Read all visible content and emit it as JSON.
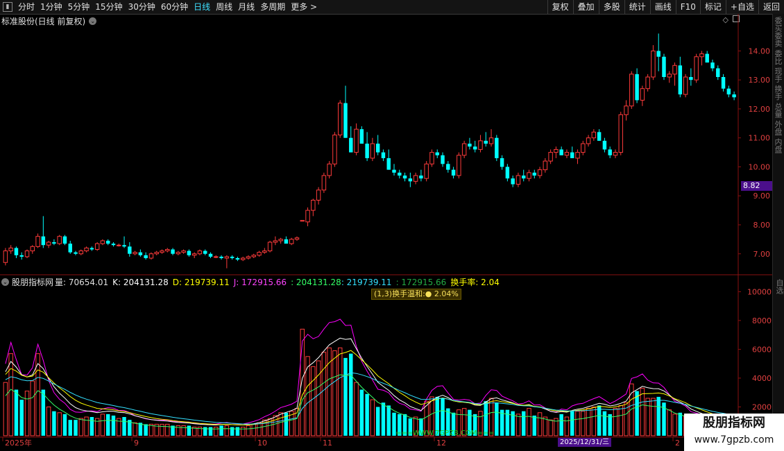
{
  "toolbar": {
    "periods": [
      "分时",
      "1分钟",
      "5分钟",
      "15分钟",
      "30分钟",
      "60分钟",
      "日线",
      "周线",
      "月线",
      "多周期",
      "更多 >"
    ],
    "active_period": "日线",
    "actions": [
      "复权",
      "叠加",
      "多股",
      "统计",
      "画线",
      "F10",
      "标记",
      "+自选",
      "返回"
    ]
  },
  "chart_title": "标准股份(日线 前复权)",
  "price_axis_labels": [
    "14.00",
    "13.00",
    "12.00",
    "11.00",
    "10.00",
    "9.00",
    "8.00",
    "7.00"
  ],
  "current_price_tag": "8.82",
  "indicator_header": {
    "name": "股朋指标网",
    "vol": "量: 70654.01",
    "k": "K: 204131.28",
    "d": "D: 219739.11",
    "j": "J: 172915.66",
    "v4": ": 204131.28",
    "v5": ": 219739.11",
    "v6": ": 172915.66",
    "turnover": "换手率: 2.04"
  },
  "badge": "(1,3)换手温和:● 2.04%",
  "volume_axis_labels": [
    "10000",
    "8000",
    "6000",
    "4000",
    "2000"
  ],
  "date_labels": [
    "2025年",
    "9",
    "10",
    "11",
    "12",
    "2"
  ],
  "date_tag": "2025/12/31/三",
  "watermark_line": "===WWW.7GPZB.COM===",
  "right_strip_text": "委买委卖 委比 现手 换手 总量 外盘 内盘",
  "right_strip_text2": "自选",
  "watermark": {
    "line1": "股朋指标网",
    "line2": "www.7gpzb.com"
  },
  "colors": {
    "up": "#ff3b3b",
    "down": "#00ffff",
    "k": "#ffffff",
    "d": "#ffff00",
    "j": "#ff00ff",
    "active": "#3fe0ff"
  },
  "chart_data": {
    "type": "candlestick",
    "title": "标准股份(日线 前复权)",
    "ylim": [
      6.3,
      14.8
    ],
    "ohlc": [
      [
        6.7,
        7.2,
        6.6,
        7.1
      ],
      [
        7.1,
        7.3,
        7.0,
        7.2
      ],
      [
        7.2,
        7.25,
        6.85,
        6.95
      ],
      [
        6.95,
        7.05,
        6.8,
        6.9
      ],
      [
        6.9,
        7.15,
        6.85,
        7.1
      ],
      [
        7.1,
        7.3,
        7.0,
        7.25
      ],
      [
        7.25,
        7.7,
        7.2,
        7.6
      ],
      [
        7.6,
        8.3,
        7.2,
        7.3
      ],
      [
        7.3,
        7.45,
        7.2,
        7.4
      ],
      [
        7.4,
        7.5,
        7.3,
        7.35
      ],
      [
        7.35,
        7.65,
        7.3,
        7.6
      ],
      [
        7.6,
        7.65,
        7.3,
        7.35
      ],
      [
        7.35,
        7.45,
        7.0,
        7.05
      ],
      [
        7.05,
        7.1,
        6.95,
        7.0
      ],
      [
        7.0,
        7.15,
        6.95,
        7.1
      ],
      [
        7.1,
        7.25,
        7.05,
        7.2
      ],
      [
        7.2,
        7.25,
        7.1,
        7.15
      ],
      [
        7.15,
        7.4,
        7.1,
        7.35
      ],
      [
        7.35,
        7.5,
        7.3,
        7.45
      ],
      [
        7.45,
        7.5,
        7.3,
        7.35
      ],
      [
        7.35,
        7.4,
        7.25,
        7.3
      ],
      [
        7.3,
        7.35,
        7.25,
        7.3
      ],
      [
        7.3,
        7.6,
        7.2,
        7.25
      ],
      [
        7.25,
        7.4,
        6.9,
        7.0
      ],
      [
        7.0,
        7.1,
        6.95,
        7.05
      ],
      [
        7.05,
        7.15,
        6.9,
        6.95
      ],
      [
        6.95,
        7.05,
        6.8,
        6.85
      ],
      [
        6.85,
        7.05,
        6.8,
        7.0
      ],
      [
        7.0,
        7.1,
        6.95,
        7.05
      ],
      [
        7.05,
        7.15,
        7.0,
        7.1
      ],
      [
        7.1,
        7.2,
        7.05,
        7.15
      ],
      [
        7.15,
        7.2,
        6.95,
        7.0
      ],
      [
        7.0,
        7.1,
        6.95,
        7.05
      ],
      [
        7.05,
        7.15,
        7.0,
        7.1
      ],
      [
        7.1,
        7.15,
        6.9,
        6.95
      ],
      [
        6.95,
        7.05,
        6.85,
        7.0
      ],
      [
        7.0,
        7.15,
        6.95,
        7.1
      ],
      [
        7.1,
        7.15,
        6.95,
        7.0
      ],
      [
        7.0,
        7.05,
        6.85,
        6.9
      ],
      [
        6.9,
        6.95,
        6.85,
        6.9
      ],
      [
        6.9,
        6.95,
        6.8,
        6.85
      ],
      [
        6.85,
        6.95,
        6.5,
        6.9
      ],
      [
        6.9,
        6.95,
        6.8,
        6.85
      ],
      [
        6.85,
        6.9,
        6.75,
        6.8
      ],
      [
        6.8,
        6.9,
        6.75,
        6.85
      ],
      [
        6.85,
        6.95,
        6.8,
        6.9
      ],
      [
        6.9,
        7.0,
        6.85,
        6.95
      ],
      [
        6.95,
        7.1,
        6.9,
        7.05
      ],
      [
        7.05,
        7.2,
        7.0,
        7.1
      ],
      [
        7.1,
        7.45,
        7.05,
        7.4
      ],
      [
        7.4,
        7.6,
        7.3,
        7.45
      ],
      [
        7.45,
        7.55,
        7.35,
        7.5
      ],
      [
        7.5,
        7.6,
        7.4,
        7.35
      ],
      [
        7.35,
        7.55,
        7.3,
        7.5
      ],
      [
        7.5,
        7.6,
        7.45,
        7.55
      ],
      [
        8.15,
        8.15,
        8.15,
        8.15
      ],
      [
        8.1,
        8.6,
        7.95,
        8.5
      ],
      [
        8.5,
        8.9,
        8.3,
        8.85
      ],
      [
        8.85,
        9.3,
        8.7,
        9.2
      ],
      [
        9.2,
        9.8,
        9.1,
        9.7
      ],
      [
        9.7,
        10.2,
        9.6,
        10.1
      ],
      [
        10.1,
        11.2,
        10.0,
        11.1
      ],
      [
        11.1,
        12.3,
        11.0,
        12.2
      ],
      [
        12.2,
        12.8,
        11.0,
        11.0
      ],
      [
        11.0,
        11.4,
        10.5,
        10.5
      ],
      [
        10.5,
        11.5,
        10.4,
        11.3
      ],
      [
        11.3,
        11.4,
        10.8,
        10.8
      ],
      [
        10.8,
        11.2,
        10.2,
        10.3
      ],
      [
        10.3,
        11.0,
        10.2,
        10.8
      ],
      [
        10.8,
        11.1,
        10.4,
        10.5
      ],
      [
        10.5,
        10.6,
        10.2,
        10.3
      ],
      [
        10.3,
        10.6,
        9.9,
        9.9
      ],
      [
        9.9,
        10.1,
        9.7,
        9.8
      ],
      [
        9.8,
        9.9,
        9.6,
        9.7
      ],
      [
        9.7,
        9.8,
        9.5,
        9.6
      ],
      [
        9.6,
        9.8,
        9.3,
        9.5
      ],
      [
        9.5,
        9.8,
        9.4,
        9.7
      ],
      [
        9.7,
        9.9,
        9.5,
        9.6
      ],
      [
        9.6,
        10.2,
        9.5,
        10.1
      ],
      [
        10.1,
        10.6,
        10.0,
        10.5
      ],
      [
        10.5,
        10.6,
        10.3,
        10.4
      ],
      [
        10.4,
        10.5,
        10.0,
        10.1
      ],
      [
        10.1,
        10.2,
        9.8,
        9.9
      ],
      [
        9.9,
        10.0,
        9.6,
        9.7
      ],
      [
        9.7,
        10.5,
        9.6,
        10.4
      ],
      [
        10.4,
        10.9,
        10.3,
        10.8
      ],
      [
        10.8,
        11.0,
        10.6,
        10.7
      ],
      [
        10.7,
        10.9,
        10.5,
        10.6
      ],
      [
        10.6,
        11.1,
        10.5,
        10.9
      ],
      [
        10.9,
        11.2,
        10.7,
        10.8
      ],
      [
        10.8,
        11.3,
        10.7,
        11.0
      ],
      [
        11.0,
        11.1,
        10.2,
        10.3
      ],
      [
        10.3,
        10.4,
        9.9,
        10.0
      ],
      [
        10.0,
        10.1,
        9.5,
        9.6
      ],
      [
        9.6,
        9.7,
        9.3,
        9.4
      ],
      [
        9.4,
        9.8,
        9.3,
        9.7
      ],
      [
        9.7,
        9.9,
        9.5,
        9.6
      ],
      [
        9.6,
        9.9,
        9.5,
        9.8
      ],
      [
        9.8,
        9.9,
        9.6,
        9.7
      ],
      [
        9.7,
        10.0,
        9.6,
        9.9
      ],
      [
        9.9,
        10.3,
        9.8,
        10.2
      ],
      [
        10.2,
        10.6,
        10.1,
        10.5
      ],
      [
        10.5,
        10.7,
        10.3,
        10.6
      ],
      [
        10.6,
        10.7,
        10.4,
        10.4
      ],
      [
        10.4,
        10.6,
        10.3,
        10.5
      ],
      [
        10.5,
        10.7,
        10.3,
        10.3
      ],
      [
        10.3,
        10.6,
        10.1,
        10.5
      ],
      [
        10.5,
        10.9,
        10.4,
        10.8
      ],
      [
        10.8,
        11.1,
        10.7,
        11.0
      ],
      [
        11.0,
        11.3,
        10.9,
        11.2
      ],
      [
        11.2,
        11.3,
        10.9,
        10.9
      ],
      [
        10.9,
        11.0,
        10.5,
        10.6
      ],
      [
        10.6,
        10.7,
        10.3,
        10.4
      ],
      [
        10.4,
        10.6,
        10.3,
        10.5
      ],
      [
        10.5,
        11.9,
        10.4,
        11.8
      ],
      [
        11.8,
        12.3,
        11.6,
        12.1
      ],
      [
        12.1,
        13.3,
        12.0,
        13.2
      ],
      [
        13.2,
        13.4,
        12.2,
        12.3
      ],
      [
        12.3,
        12.8,
        12.1,
        12.7
      ],
      [
        12.7,
        13.2,
        12.6,
        13.1
      ],
      [
        13.1,
        14.2,
        13.0,
        14.0
      ],
      [
        14.0,
        14.6,
        13.3,
        13.8
      ],
      [
        13.8,
        13.9,
        13.0,
        13.1
      ],
      [
        13.1,
        13.3,
        12.9,
        13.2
      ],
      [
        13.2,
        13.6,
        12.8,
        13.5
      ],
      [
        13.5,
        13.8,
        12.4,
        12.5
      ],
      [
        12.5,
        13.2,
        12.4,
        13.1
      ],
      [
        13.1,
        13.4,
        12.8,
        13.0
      ],
      [
        13.0,
        13.9,
        12.9,
        13.8
      ],
      [
        13.8,
        14.0,
        13.5,
        13.9
      ],
      [
        13.9,
        14.0,
        13.6,
        13.6
      ],
      [
        13.6,
        13.7,
        13.3,
        13.4
      ],
      [
        13.4,
        13.5,
        13.0,
        13.1
      ],
      [
        13.1,
        13.2,
        12.6,
        12.7
      ],
      [
        12.7,
        12.8,
        12.4,
        12.5
      ],
      [
        12.5,
        12.6,
        12.3,
        12.4
      ]
    ],
    "volume": [
      3700,
      5700,
      3200,
      2500,
      3100,
      3800,
      5700,
      3200,
      2000,
      1700,
      1600,
      1500,
      1100,
      1100,
      1200,
      1300,
      1300,
      1200,
      1500,
      1500,
      1400,
      1200,
      1300,
      1100,
      900,
      900,
      800,
      800,
      800,
      800,
      800,
      700,
      700,
      700,
      700,
      600,
      600,
      600,
      600,
      600,
      700,
      700,
      600,
      600,
      600,
      700,
      800,
      900,
      1100,
      1200,
      1400,
      1600,
      1600,
      1700,
      1900,
      7400,
      5500,
      4800,
      5200,
      5800,
      6100,
      5900,
      6100,
      5400,
      5700,
      3700,
      3200,
      2900,
      2500,
      2000,
      2300,
      2100,
      1600,
      1500,
      1500,
      1200,
      1300,
      1200,
      2400,
      2700,
      2700,
      2600,
      1900,
      1600,
      1800,
      1900,
      1800,
      1500,
      1700,
      2400,
      2600,
      2300,
      1800,
      1800,
      1700,
      1500,
      1700,
      1900,
      1400,
      1600,
      1300,
      1100,
      1200,
      1500,
      1300,
      1700,
      1700,
      1700,
      1900,
      2000,
      2100,
      1700,
      1500,
      1900,
      2100,
      2300,
      3600,
      3100,
      3300,
      2600,
      2600,
      2700,
      2300,
      1800,
      1500,
      1600,
      1400,
      1000,
      1100,
      1000,
      900,
      800,
      900,
      1000,
      800
    ],
    "k_line": [],
    "volume_ylim": [
      0,
      10500
    ]
  }
}
